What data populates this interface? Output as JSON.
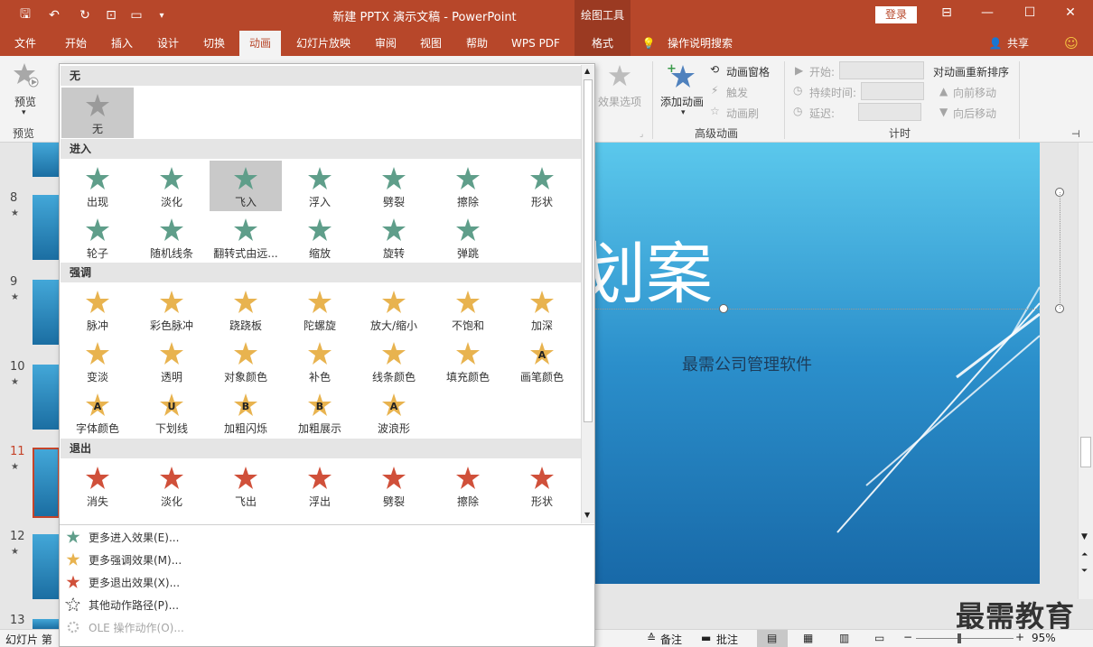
{
  "titlebar": {
    "doc_title": "新建 PPTX 演示文稿 - PowerPoint",
    "drawing_tools": "绘图工具",
    "login": "登录"
  },
  "tabs": [
    "文件",
    "开始",
    "插入",
    "设计",
    "切换",
    "动画",
    "幻灯片放映",
    "审阅",
    "视图",
    "帮助",
    "WPS PDF",
    "格式"
  ],
  "active_tab": "动画",
  "tell_me": "操作说明搜索",
  "share": "共享",
  "ribbon": {
    "preview": "预览",
    "preview_group": "预览",
    "effect_options": "效果选项",
    "add_animation": "添加动画",
    "animation_pane": "动画窗格",
    "trigger": "触发",
    "animation_painter": "动画刷",
    "advanced_group": "高级动画",
    "start": "开始:",
    "duration": "持续时间:",
    "delay": "延迟:",
    "timing_group": "计时",
    "reorder": "对动画重新排序",
    "move_earlier": "向前移动",
    "move_later": "向后移动"
  },
  "thumbs": [
    "8",
    "9",
    "10",
    "11",
    "12",
    "13"
  ],
  "slide": {
    "title": "划案",
    "subtitle": "最需公司管理软件"
  },
  "statusbar": {
    "slide_label": "幻灯片 第",
    "notes": "备注",
    "comments": "批注",
    "zoom": "95%"
  },
  "watermark": "最需教育",
  "gallery": {
    "none_header": "无",
    "none_label": "无",
    "entrance_header": "进入",
    "entrance": [
      "出现",
      "淡化",
      "飞入",
      "浮入",
      "劈裂",
      "擦除",
      "形状",
      "轮子",
      "随机线条",
      "翻转式由远...",
      "缩放",
      "旋转",
      "弹跳"
    ],
    "emphasis_header": "强调",
    "emphasis": [
      "脉冲",
      "彩色脉冲",
      "跷跷板",
      "陀螺旋",
      "放大/缩小",
      "不饱和",
      "加深",
      "变淡",
      "透明",
      "对象颜色",
      "补色",
      "线条颜色",
      "填充颜色",
      "画笔颜色",
      "字体颜色",
      "下划线",
      "加粗闪烁",
      "加粗展示",
      "波浪形"
    ],
    "emphasis_letters": {
      "13": "A",
      "14": "A",
      "15": "U",
      "16": "B",
      "17": "B",
      "18": "A"
    },
    "exit_header": "退出",
    "exit": [
      "消失",
      "淡化",
      "飞出",
      "浮出",
      "劈裂",
      "擦除",
      "形状"
    ],
    "more": [
      "更多进入效果(E)...",
      "更多强调效果(M)...",
      "更多退出效果(X)...",
      "其他动作路径(P)...",
      "OLE 操作动作(O)..."
    ]
  },
  "colors": {
    "brand": "#b7472a",
    "entrance": "#5f9e8a",
    "emphasis": "#e8b34f",
    "exit": "#d0503a"
  }
}
